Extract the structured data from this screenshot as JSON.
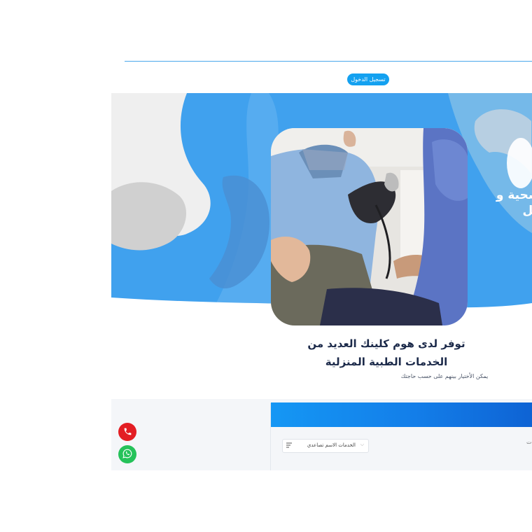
{
  "header": {
    "login_label": "تسجيل الدخول"
  },
  "hero": {
    "tagline_line1": "لصحية و",
    "tagline_line2": "يكل"
  },
  "intro": {
    "heading_line1": "توفر لدى هوم كلينك العديد من",
    "heading_line2": "الخدمات الطبية المنزلية",
    "subtext": "يمكن الأختيار بينهم على حسب حاجتك"
  },
  "services": {
    "sort_label": "الخدمات الاسم تصاعدي",
    "sort_chevron": "⌵",
    "cut_label": "ت"
  },
  "colors": {
    "primary_blue": "#40a1ee",
    "login_blue": "#14a1f0",
    "phone_red": "#e31e24",
    "whatsapp_green": "#25c25a"
  },
  "icons": {
    "phone": "phone-icon",
    "whatsapp": "whatsapp-icon",
    "sort": "sort-icon"
  }
}
